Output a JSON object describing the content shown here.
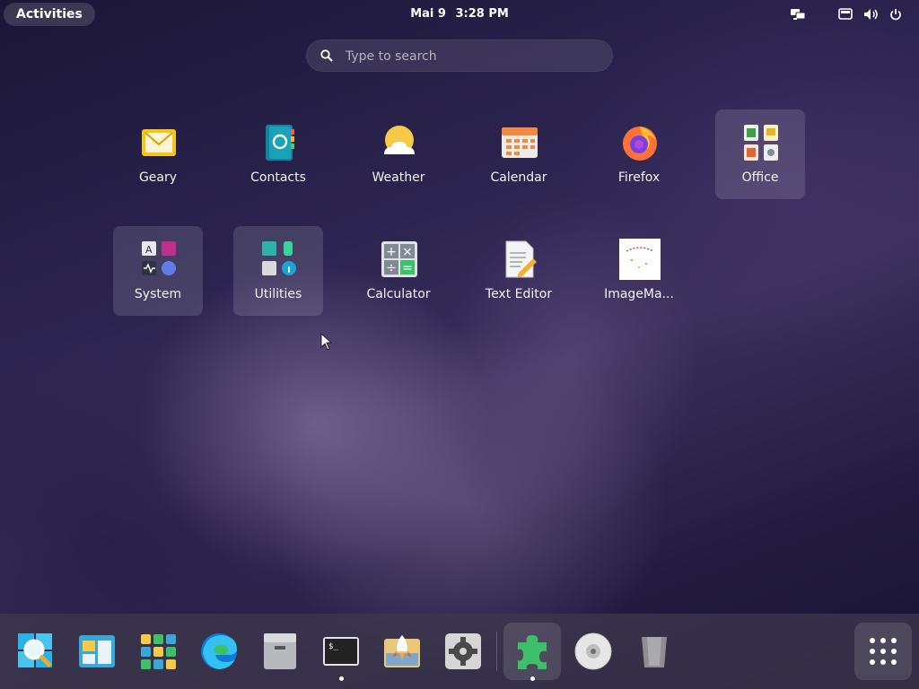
{
  "topbar": {
    "activities_label": "Activities",
    "date": "Mai 9",
    "time": "3:28 PM",
    "tray_icons": [
      "network-wired-icon",
      "keyboard-layout-icon",
      "volume-icon",
      "power-icon"
    ]
  },
  "search": {
    "placeholder": "Type to search"
  },
  "apps": [
    {
      "name": "Geary",
      "icon": "mail-envelope-icon",
      "folder": false
    },
    {
      "name": "Contacts",
      "icon": "address-book-icon",
      "folder": false
    },
    {
      "name": "Weather",
      "icon": "sun-cloud-icon",
      "folder": false
    },
    {
      "name": "Calendar",
      "icon": "calendar-icon",
      "folder": false
    },
    {
      "name": "Firefox",
      "icon": "firefox-icon",
      "folder": false
    },
    {
      "name": "Office",
      "icon": "office-folder-icon",
      "folder": true
    },
    {
      "name": "System",
      "icon": "system-folder-icon",
      "folder": true
    },
    {
      "name": "Utilities",
      "icon": "utilities-folder-icon",
      "folder": true
    },
    {
      "name": "Calculator",
      "icon": "calculator-icon",
      "folder": false
    },
    {
      "name": "Text Editor",
      "icon": "text-editor-icon",
      "folder": false
    },
    {
      "name": "ImageMa...",
      "icon": "imagemagick-icon",
      "folder": false
    }
  ],
  "dock": [
    {
      "name": "Search / Magnifier",
      "icon": "magnifier-icon",
      "running": false
    },
    {
      "name": "Window switcher",
      "icon": "window-layout-icon",
      "running": false
    },
    {
      "name": "App grid launcher",
      "icon": "tiles-icon",
      "running": false
    },
    {
      "name": "Microsoft Edge",
      "icon": "edge-icon",
      "running": false
    },
    {
      "name": "Files",
      "icon": "file-cabinet-icon",
      "running": false
    },
    {
      "name": "Terminal",
      "icon": "terminal-icon",
      "running": true
    },
    {
      "name": "Software installer",
      "icon": "rocket-icon",
      "running": false
    },
    {
      "name": "Settings",
      "icon": "gear-icon",
      "running": false
    },
    {
      "name": "Extensions",
      "icon": "puzzle-icon",
      "running": true
    },
    {
      "name": "Disc",
      "icon": "disc-icon",
      "running": false
    },
    {
      "name": "Trash",
      "icon": "trash-icon",
      "running": false
    },
    {
      "name": "Show Applications",
      "icon": "grid-dots-icon",
      "running": false
    }
  ],
  "terminal_prompt": "$_",
  "colors": {
    "accent_green": "#3ec06a",
    "folder_bg": "rgba(255,255,255,0.13)"
  }
}
